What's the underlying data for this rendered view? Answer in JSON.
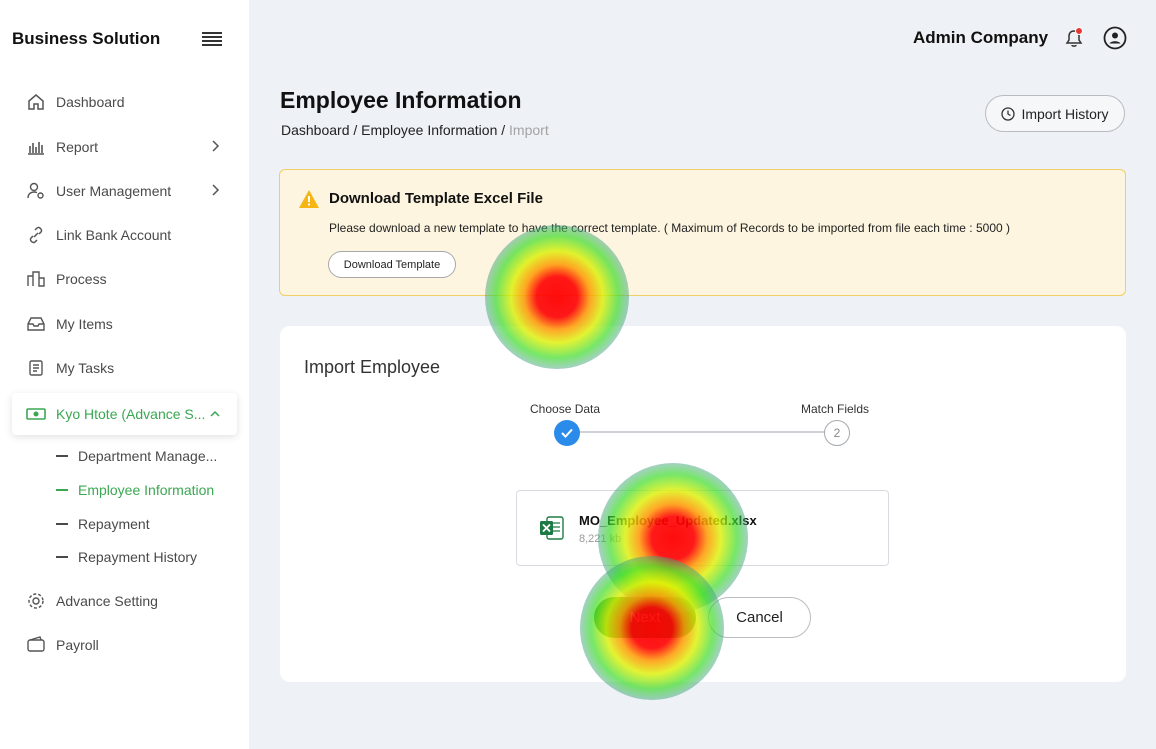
{
  "sidebar": {
    "brand": "Business Solution",
    "items": [
      {
        "label": "Dashboard"
      },
      {
        "label": "Report"
      },
      {
        "label": "User Management"
      },
      {
        "label": "Link Bank Account"
      },
      {
        "label": "Process"
      },
      {
        "label": "My Items"
      },
      {
        "label": "My Tasks"
      },
      {
        "label": "Kyo Htote (Advance S..."
      },
      {
        "label": "Advance Setting"
      },
      {
        "label": "Payroll"
      }
    ],
    "sub_items": [
      {
        "label": "Department Manage..."
      },
      {
        "label": "Employee Information"
      },
      {
        "label": "Repayment"
      },
      {
        "label": "Repayment History"
      }
    ]
  },
  "header": {
    "company": "Admin Company"
  },
  "page": {
    "title": "Employee Information",
    "breadcrumb": {
      "part1": "Dashboard",
      "sep": " / ",
      "part2": "Employee Information",
      "part3": "Import"
    },
    "import_history_label": "Import History"
  },
  "alert": {
    "title": "Download Template Excel File",
    "text": "Please download a new template to have the correct template. ( Maximum of Records to be imported from file each time : 5000 )",
    "button_label": "Download Template"
  },
  "card": {
    "title": "Import Employee",
    "steps": [
      {
        "label": "Choose Data",
        "status": "done"
      },
      {
        "label": "Match Fields",
        "number": "2"
      }
    ],
    "file": {
      "name": "MO_Employee_Updated.xlsx",
      "size": "8,221 kb"
    },
    "next_label": "Next",
    "cancel_label": "Cancel"
  },
  "colors": {
    "accent_green": "#3aa852",
    "button_green": "#1f9a3c",
    "step_blue": "#2b8bea",
    "alert_bg": "#fdf5df",
    "alert_border": "#f0cf68"
  }
}
